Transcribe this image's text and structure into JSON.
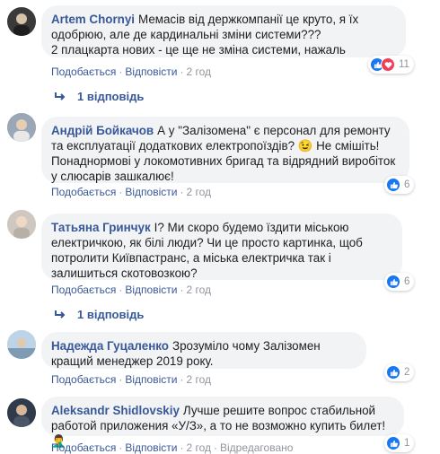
{
  "comments": [
    {
      "author": "Artem Chornyi",
      "text": "Мемасів від держкомпанії це круто, я їх одобрюю, але де кардинальні зміни системи???\n2 плацкарта нових - це ще не зміна системи, нажаль",
      "like": "Подобається",
      "reply": "Відповісти",
      "time": "2 год",
      "reactions": "11",
      "reaction_icons": [
        "like-icon",
        "love-icon"
      ],
      "replies": "1 відповідь"
    },
    {
      "author": "Андрій Бойкачов",
      "text": "А у \"Залізомена\" є персонал для ремонту та експлуатації додаткових електропоїздів? 😉 Не смішіть! Понаднормові у локомотивних бригад та відрядний виробіток у слюсарів зашкалює!",
      "like": "Подобається",
      "reply": "Відповісти",
      "time": "2 год",
      "reactions": "6",
      "reaction_icons": [
        "like-icon"
      ]
    },
    {
      "author": "Татьяна Гринчук",
      "text": "І? Ми скоро будемо їздити міською електричкою, як білі люди? Чи це просто картинка, щоб потролити Київпастранс, а міська електричка так і залишиться скотовозкою?",
      "like": "Подобається",
      "reply": "Відповісти",
      "time": "2 год",
      "reactions": "6",
      "reaction_icons": [
        "like-icon"
      ],
      "replies": "1 відповідь"
    },
    {
      "author": "Надежда Гуцаленко",
      "text": "Зрозуміло чому Залізомен кращий менеджер 2019 року.",
      "like": "Подобається",
      "reply": "Відповісти",
      "time": "2 год",
      "reactions": "2",
      "reaction_icons": [
        "like-icon"
      ]
    },
    {
      "author": "Aleksandr Shidlovskiy",
      "text": "Лучше решите вопрос стабильной работой приложения «У/З», а то не возможно купить билет! 🤦‍♂️",
      "like": "Подобається",
      "reply": "Відповісти",
      "time": "2 год",
      "edited": "Відредаговано",
      "reactions": "1",
      "reaction_icons": [
        "like-icon"
      ]
    }
  ],
  "colors": {
    "link": "#385898",
    "bubble": "#f2f3f5",
    "like": "#1877f2",
    "love": "#f33e58"
  }
}
